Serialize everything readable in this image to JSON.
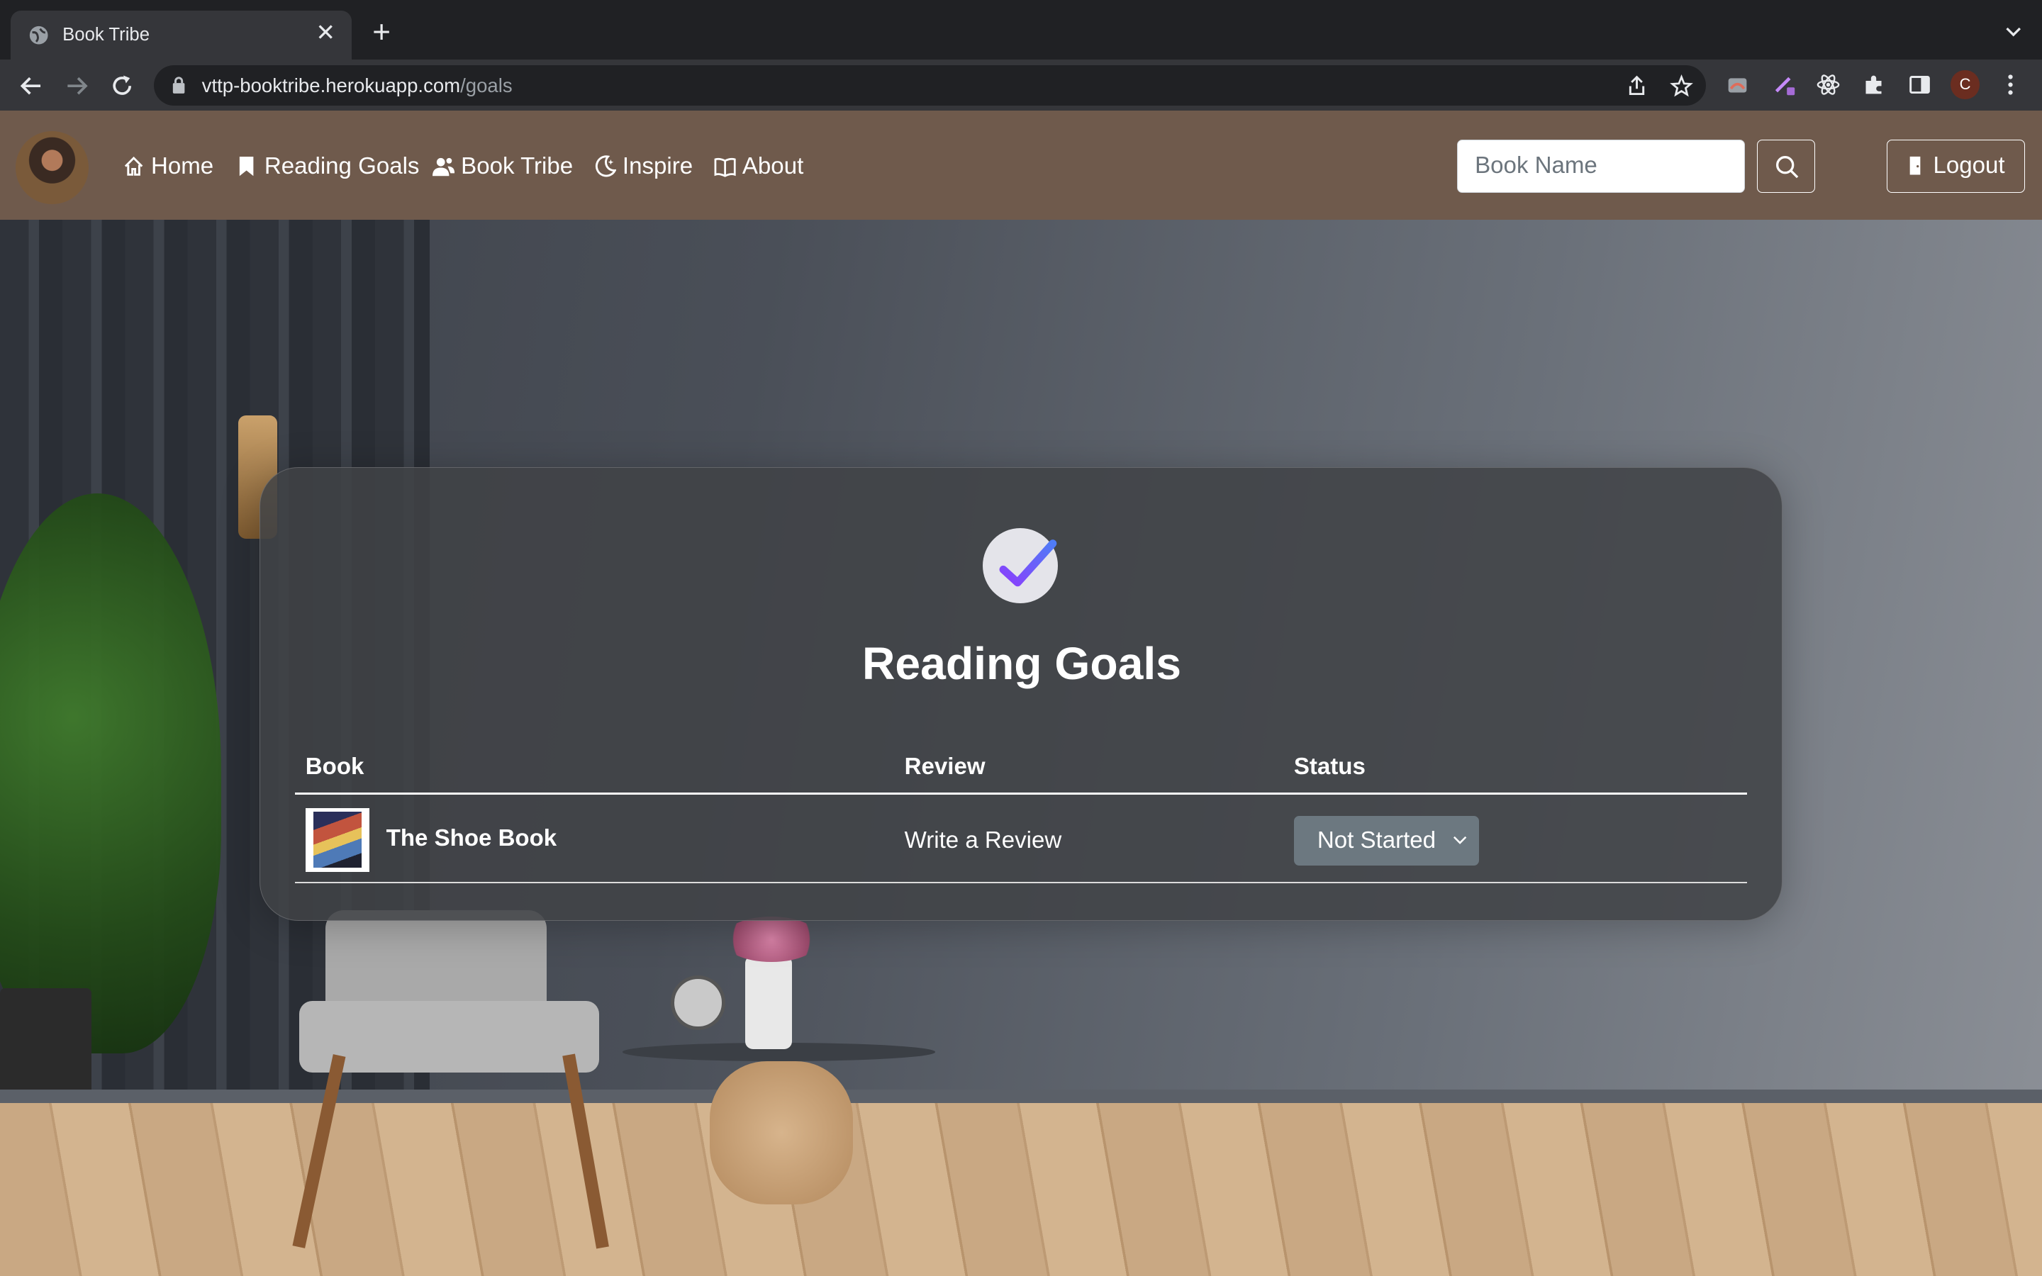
{
  "browser": {
    "tab_title": "Book Tribe",
    "url_host": "vttp-booktribe.herokuapp.com",
    "url_path": "/goals",
    "profile_initial": "C"
  },
  "navbar": {
    "links": [
      {
        "label": "Home",
        "icon": "home-icon"
      },
      {
        "label": "Reading Goals",
        "icon": "bookmark-icon"
      },
      {
        "label": "Book Tribe",
        "icon": "people-icon"
      },
      {
        "label": "Inspire",
        "icon": "moon-icon"
      },
      {
        "label": "About",
        "icon": "book-open-icon"
      }
    ],
    "search_placeholder": "Book Name",
    "logout_label": "Logout",
    "bg_color": "#6f5a4c"
  },
  "goals": {
    "title": "Reading Goals",
    "columns": [
      "Book",
      "Review",
      "Status"
    ],
    "rows": [
      {
        "book": "The Shoe Book",
        "review": "Write a Review",
        "status": "Not Started"
      }
    ]
  }
}
